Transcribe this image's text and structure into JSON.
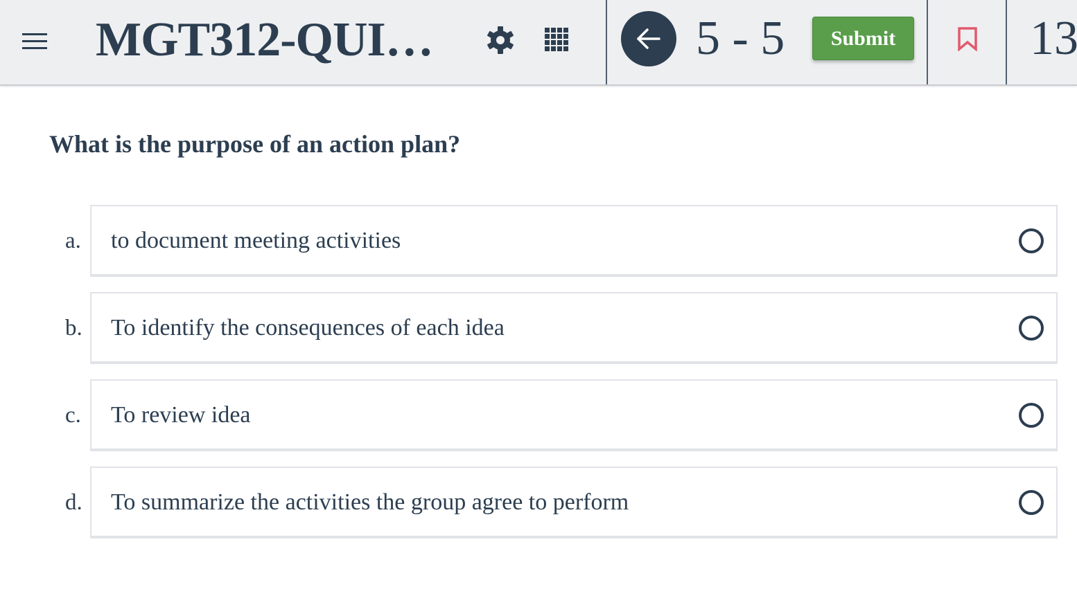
{
  "header": {
    "quiz_title": "MGT312-QUI…",
    "page_range": "5 - 5",
    "submit_label": "Submit",
    "timer_text": "13",
    "icons": {
      "menu": "hamburger-menu-icon",
      "settings": "gear-icon",
      "grid": "grid-icon",
      "back": "arrow-left-icon",
      "bookmark": "bookmark-icon"
    }
  },
  "question": {
    "text": "What is the purpose of an action plan?",
    "options": [
      {
        "letter": "a.",
        "text": "to document meeting activities",
        "selected": false
      },
      {
        "letter": "b.",
        "text": "To identify the consequences of each idea",
        "selected": false
      },
      {
        "letter": "c.",
        "text": "To review idea",
        "selected": false
      },
      {
        "letter": "d.",
        "text": "To summarize the activities the group agree to perform",
        "selected": false
      }
    ]
  },
  "colors": {
    "text": "#2c3e50",
    "submit": "#5a9e4c",
    "bookmark": "#e05a6e",
    "header_bg": "#eeeff1"
  }
}
